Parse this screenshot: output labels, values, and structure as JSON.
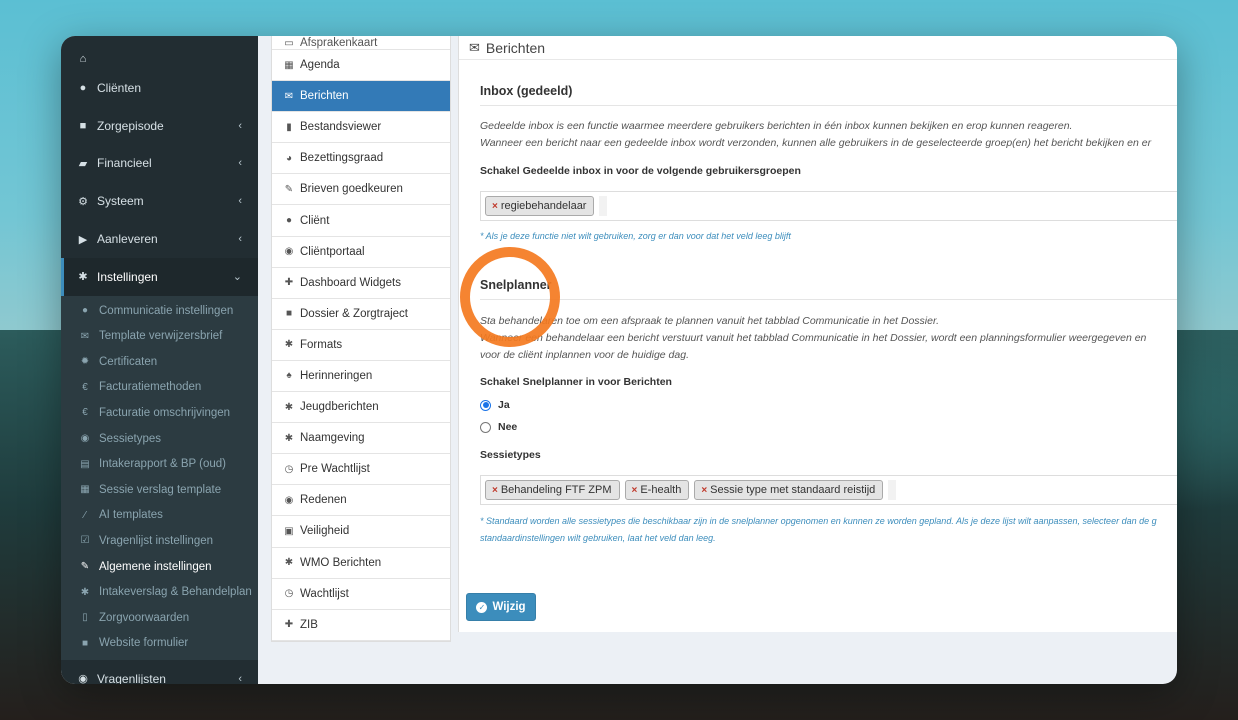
{
  "sidebar": {
    "items": [
      {
        "label": "",
        "icon": "home-icon"
      },
      {
        "label": "Cliënten",
        "icon": "user-icon"
      },
      {
        "label": "Zorgepisode",
        "icon": "briefcase-icon"
      },
      {
        "label": "Financieel",
        "icon": "book-icon"
      },
      {
        "label": "Systeem",
        "icon": "cogs-icon"
      },
      {
        "label": "Aanleveren",
        "icon": "truck-icon"
      },
      {
        "label": "Instellingen",
        "icon": "gear-icon"
      }
    ],
    "submenu": [
      {
        "label": "Communicatie instellingen",
        "icon": "comments-icon"
      },
      {
        "label": "Template verwijzersbrief",
        "icon": "envelope-icon"
      },
      {
        "label": "Certificaten",
        "icon": "certificate-icon"
      },
      {
        "label": "Facturatiemethoden",
        "icon": "euro-icon"
      },
      {
        "label": "Facturatie omschrijvingen",
        "icon": "euro-icon"
      },
      {
        "label": "Sessietypes",
        "icon": "globe-icon"
      },
      {
        "label": "Intakerapport & BP (oud)",
        "icon": "file-icon"
      },
      {
        "label": "Sessie verslag template",
        "icon": "file-text-icon"
      },
      {
        "label": "AI templates",
        "icon": "magic-icon"
      },
      {
        "label": "Vragenlijst instellingen",
        "icon": "check-square-icon"
      },
      {
        "label": "Algemene instellingen",
        "icon": "wrench-icon"
      },
      {
        "label": "Intakeverslag & Behandelplan",
        "icon": "gear-icon"
      },
      {
        "label": "Zorgvoorwaarden",
        "icon": "file-pdf-icon"
      },
      {
        "label": "Website formulier",
        "icon": "briefcase-icon"
      }
    ],
    "bottom": {
      "label": "Vragenlijsten",
      "icon": "globe-icon"
    }
  },
  "midmenu": {
    "items": [
      {
        "label": "Afsprakenkaart",
        "icon": "card-icon"
      },
      {
        "label": "Agenda",
        "icon": "calendar-icon"
      },
      {
        "label": "Berichten",
        "icon": "envelope-icon"
      },
      {
        "label": "Bestandsviewer",
        "icon": "file-icon"
      },
      {
        "label": "Bezettingsgraad",
        "icon": "pie-chart-icon"
      },
      {
        "label": "Brieven goedkeuren",
        "icon": "edit-icon"
      },
      {
        "label": "Cliënt",
        "icon": "user-icon"
      },
      {
        "label": "Cliëntportaal",
        "icon": "globe-icon"
      },
      {
        "label": "Dashboard Widgets",
        "icon": "puzzle-icon"
      },
      {
        "label": "Dossier & Zorgtraject",
        "icon": "briefcase-icon"
      },
      {
        "label": "Formats",
        "icon": "gear-icon"
      },
      {
        "label": "Herinneringen",
        "icon": "bell-icon"
      },
      {
        "label": "Jeugdberichten",
        "icon": "gear-icon"
      },
      {
        "label": "Naamgeving",
        "icon": "gear-icon"
      },
      {
        "label": "Pre Wachtlijst",
        "icon": "clock-icon"
      },
      {
        "label": "Redenen",
        "icon": "globe-icon"
      },
      {
        "label": "Veiligheid",
        "icon": "lock-icon"
      },
      {
        "label": "WMO Berichten",
        "icon": "gear-icon"
      },
      {
        "label": "Wachtlijst",
        "icon": "clock-icon"
      },
      {
        "label": "ZIB",
        "icon": "puzzle-icon"
      }
    ]
  },
  "panel": {
    "title": "Berichten",
    "inbox": {
      "heading": "Inbox (gedeeld)",
      "desc1": "Gedeelde inbox is een functie waarmee meerdere gebruikers berichten in één inbox kunnen bekijken en erop kunnen reageren.",
      "desc2": "Wanneer een bericht naar een gedeelde inbox wordt verzonden, kunnen alle gebruikers in de geselecteerde groep(en) het bericht bekijken en er",
      "label": "Schakel Gedeelde inbox in voor de volgende gebruikersgroepen",
      "tags": [
        "regiebehandelaar"
      ],
      "help": "* Als je deze functie niet wilt gebruiken, zorg er dan voor dat het veld leeg blijft"
    },
    "snelplanner": {
      "heading": "Snelplanner",
      "desc1": "Sta behandelaren toe om een afspraak te plannen vanuit het tabblad Communicatie in het Dossier.",
      "desc2": "Wanneer een behandelaar een bericht verstuurt vanuit het tabblad Communicatie in het Dossier, wordt een planningsformulier weergegeven en",
      "desc3": "voor de cliënt inplannen voor de huidige dag.",
      "label": "Schakel Snelplanner in voor Berichten",
      "option_yes": "Ja",
      "option_no": "Nee",
      "sessietypes_label": "Sessietypes",
      "tags": [
        "Behandeling FTF ZPM",
        "E-health",
        "Sessie type met standaard reistijd"
      ],
      "help1": "* Standaard worden alle sessietypes die beschikbaar zijn in de snelplanner opgenomen en kunnen ze worden gepland. Als je deze lijst wilt aanpassen, selecteer dan de g",
      "help2": "standaardinstellingen wilt gebruiken, laat het veld dan leeg."
    },
    "save_label": "Wijzig"
  }
}
